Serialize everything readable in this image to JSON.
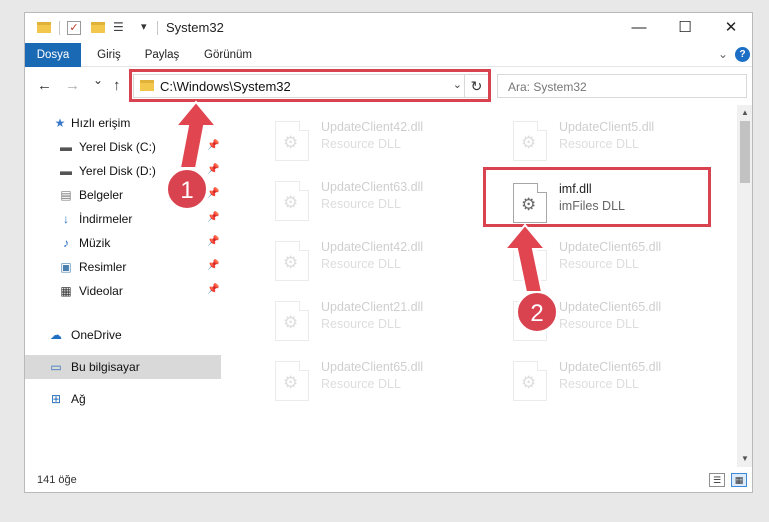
{
  "window": {
    "title": "System32"
  },
  "ribbon": {
    "tabs": [
      "Dosya",
      "Giriş",
      "Paylaş",
      "Görünüm"
    ],
    "help": "?"
  },
  "navigation": {
    "back_icon": "←",
    "forward_icon": "→",
    "recent_icon": "⌄",
    "up_icon": "↑",
    "address": "C:\\Windows\\System32",
    "refresh_icon": "↻",
    "search_placeholder": "Ara: System32"
  },
  "sidebar": {
    "items": [
      {
        "label": "Hızlı erişim",
        "icon": "star-icon"
      },
      {
        "label": "Yerel Disk (C:)",
        "icon": "drive-icon"
      },
      {
        "label": "Yerel Disk (D:)",
        "icon": "drive-icon"
      },
      {
        "label": "Belgeler",
        "icon": "documents-icon"
      },
      {
        "label": "İndirmeler",
        "icon": "download-icon"
      },
      {
        "label": "Müzik",
        "icon": "music-icon"
      },
      {
        "label": "Resimler",
        "icon": "pictures-icon"
      },
      {
        "label": "Videolar",
        "icon": "videos-icon"
      },
      {
        "label": "OneDrive",
        "icon": "cloud-icon"
      },
      {
        "label": "Bu bilgisayar",
        "icon": "computer-icon"
      },
      {
        "label": "Ağ",
        "icon": "network-icon"
      }
    ]
  },
  "files": [
    {
      "name": "UpdateClient42.dll",
      "type": "Resource DLL"
    },
    {
      "name": "UpdateClient5.dll",
      "type": "Resource DLL"
    },
    {
      "name": "UpdateClient63.dll",
      "type": "Resource DLL"
    },
    {
      "name": "imf.dll",
      "type": "imFiles DLL"
    },
    {
      "name": "UpdateClient42.dll",
      "type": "Resource DLL"
    },
    {
      "name": "UpdateClient65.dll",
      "type": "Resource DLL"
    },
    {
      "name": "UpdateClient21.dll",
      "type": "Resource DLL"
    },
    {
      "name": "UpdateClient65.dll",
      "type": "Resource DLL"
    },
    {
      "name": "UpdateClient65.dll",
      "type": "Resource DLL"
    },
    {
      "name": "UpdateClient65.dll",
      "type": "Resource DLL"
    }
  ],
  "status": {
    "count": "141 öğe"
  },
  "annotations": {
    "step1": "1",
    "step2": "2"
  },
  "colors": {
    "accent": "#1a69b4",
    "highlight": "#d9434f"
  }
}
